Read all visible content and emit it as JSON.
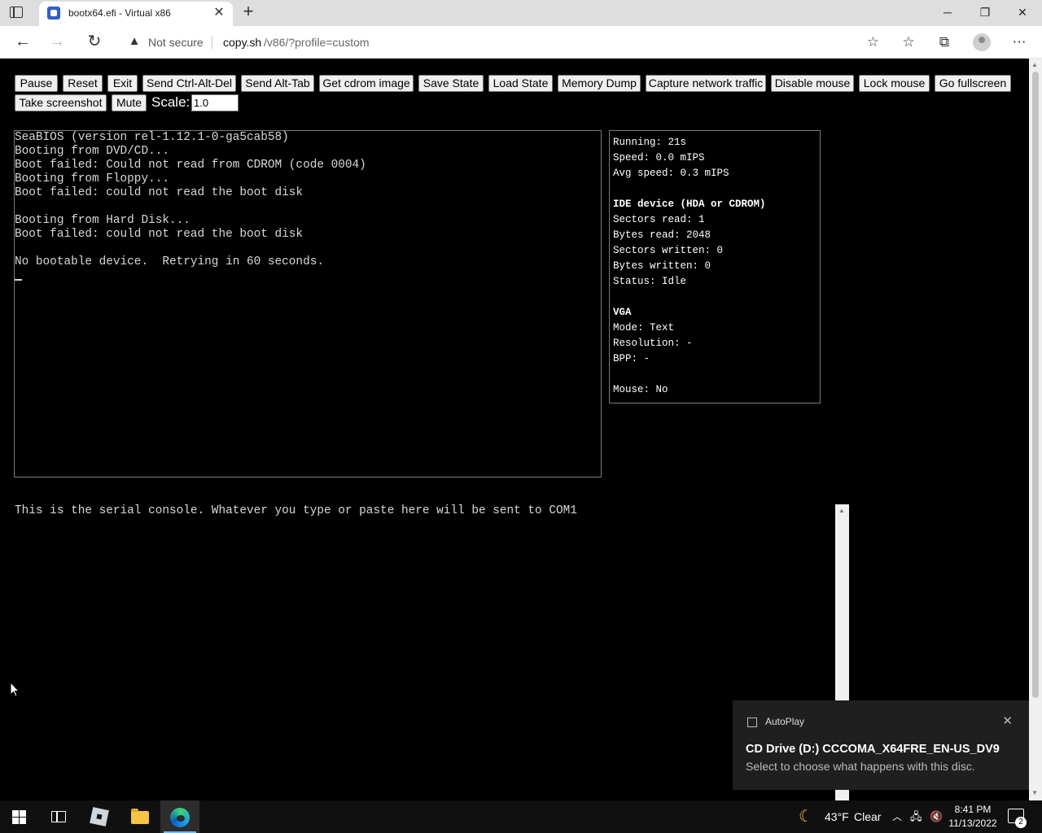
{
  "browser": {
    "tab_title": "bootx64.efi - Virtual x86",
    "new_tab_symbol": "+",
    "security_label": "Not secure",
    "url_host": "copy.sh",
    "url_path": "/v86/?profile=custom",
    "icons": [
      "tab-actions-icon",
      "v86-favicon",
      "close-icon",
      "new-tab-icon",
      "minimize-icon",
      "restore-icon",
      "window-close-icon",
      "back-icon",
      "forward-icon",
      "refresh-icon",
      "warning-icon",
      "add-favorite-icon",
      "favorites-icon",
      "collections-icon",
      "profile-icon",
      "more-icon"
    ]
  },
  "toolbar": {
    "buttons": [
      "Pause",
      "Reset",
      "Exit",
      "Send Ctrl-Alt-Del",
      "Send Alt-Tab",
      "Get cdrom image",
      "Save State",
      "Load State",
      "Memory Dump",
      "Capture network traffic",
      "Disable mouse",
      "Lock mouse",
      "Go fullscreen"
    ],
    "buttons_row2": [
      "Take screenshot",
      "Mute"
    ],
    "scale_label": "Scale:",
    "scale_value": "1.0"
  },
  "screen": {
    "lines": [
      "SeaBIOS (version rel-1.12.1-0-ga5cab58)",
      "Booting from DVD/CD...",
      "Boot failed: Could not read from CDROM (code 0004)",
      "Booting from Floppy...",
      "Boot failed: could not read the boot disk",
      "",
      "Booting from Hard Disk...",
      "Boot failed: could not read the boot disk",
      "",
      "No bootable device.  Retrying in 60 seconds."
    ]
  },
  "info": {
    "running": "Running: 21s",
    "speed": "Speed: 0.0 mIPS",
    "avg_speed": "Avg speed: 0.3 mIPS",
    "ide_title": "IDE device (HDA or CDROM)",
    "sectors_read": "Sectors read: 1",
    "bytes_read": "Bytes read: 2048",
    "sectors_written": "Sectors written: 0",
    "bytes_written": "Bytes written: 0",
    "status": "Status: Idle",
    "vga_title": "VGA",
    "mode": "Mode: Text",
    "resolution": "Resolution: -",
    "bpp": "BPP: -",
    "mouse": "Mouse: No"
  },
  "serial": {
    "text": "This is the serial console. Whatever you type or paste here will be sent to COM1"
  },
  "toast": {
    "app": "AutoPlay",
    "heading": "CD Drive (D:) CCCOMA_X64FRE_EN-US_DV9",
    "body": "Select to choose what happens with this disc."
  },
  "taskbar": {
    "weather_temp": "43°F",
    "weather_text": "Clear",
    "time": "8:41 PM",
    "date": "11/13/2022",
    "notification_count": "2",
    "apps": [
      "start-icon",
      "task-view-icon",
      "roblox-icon",
      "file-explorer-icon",
      "edge-icon"
    ]
  }
}
